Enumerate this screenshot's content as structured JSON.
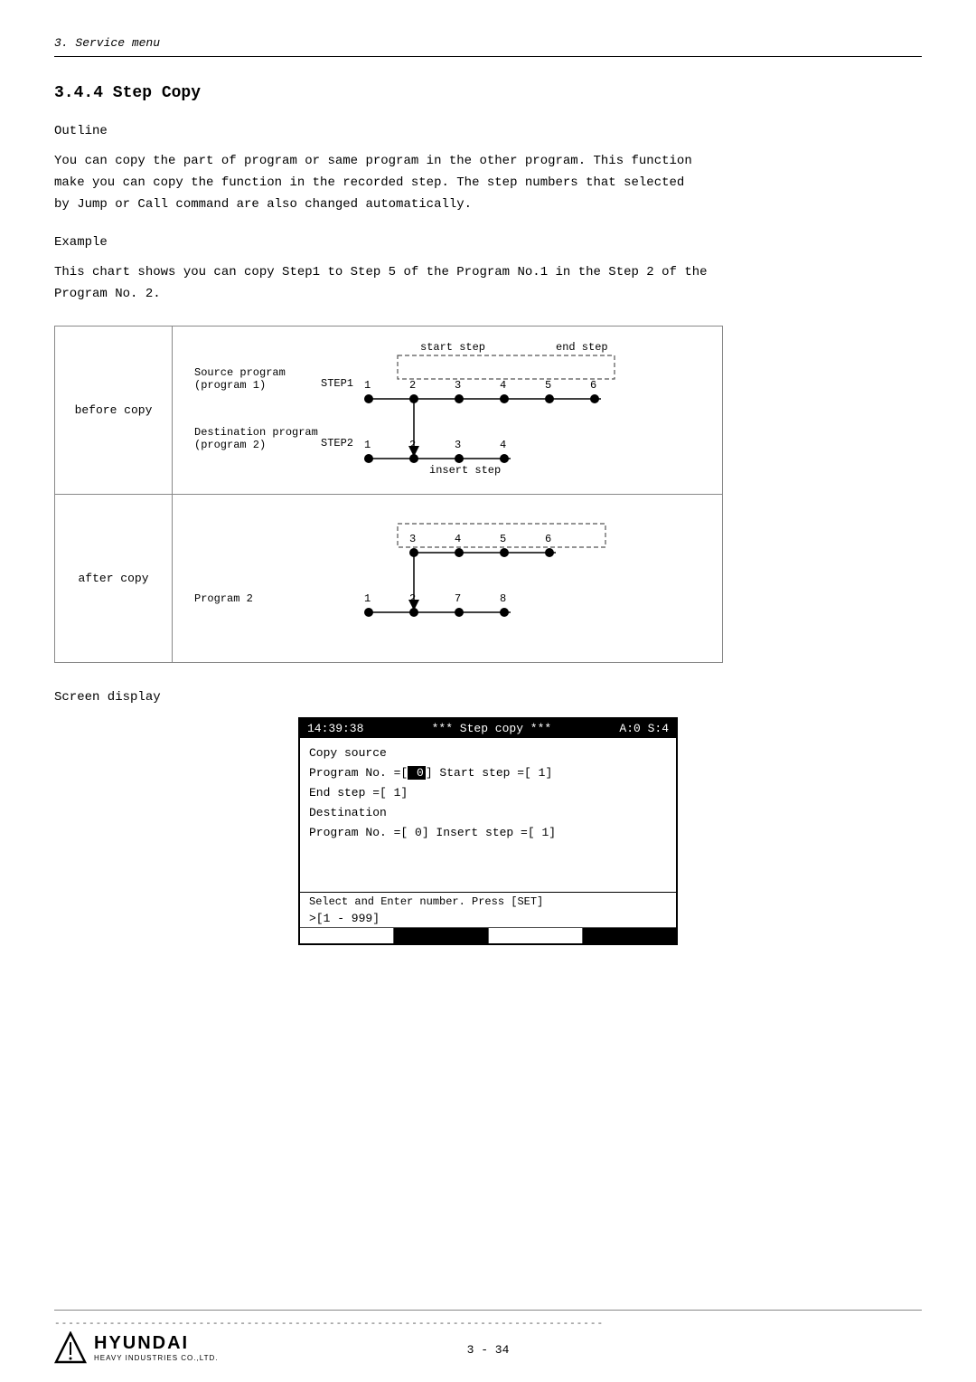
{
  "header": {
    "section_label": "3. Service menu"
  },
  "section_title": "3.4.4  Step Copy",
  "outline_label": "Outline",
  "outline_text": "You can copy the part of program or same program in the other program. This function\nmake you can copy the function in the recorded step. The step numbers that selected\nby Jump or Call command are also changed automatically.",
  "example_label": "Example",
  "example_text": "This chart shows you can copy Step1 to Step 5 of the Program No.1 in the Step 2 of the\nProgram No. 2.",
  "before_copy_label": "before copy",
  "after_copy_label": "after copy",
  "source_program_label": "Source program\n(program 1)",
  "destination_program_label": "Destination program\n(program 2)",
  "program2_label": "Program 2",
  "step1_label": "STEP1",
  "step2_label": "STEP2",
  "start_step_label": "start step",
  "end_step_label": "end step",
  "insert_step_label": "insert step",
  "screen_display_label": "Screen display",
  "screen": {
    "header_time": "14:39:38",
    "header_mode": "*** Step copy ***",
    "header_status": "A:0 S:4",
    "line1": "Copy source",
    "line2_prefix": "Program No.  =[",
    "line2_highlight": " 0",
    "line2_suffix": "] Start step  =[  1]",
    "line3": "                   End step =[  1]",
    "line4": "Destination",
    "line5": "Program No.  =[  0] Insert step =[  1]",
    "footer_text": "Select and Enter number. Press [SET]",
    "input_row": ">[1 - 999]"
  },
  "footer": {
    "dashes": "--------------------------------------------------------------------------------",
    "page_number": "3 - 34",
    "logo_text": "HYUNDAI",
    "logo_subtext": "HEAVY INDUSTRIES CO.,LTD."
  }
}
